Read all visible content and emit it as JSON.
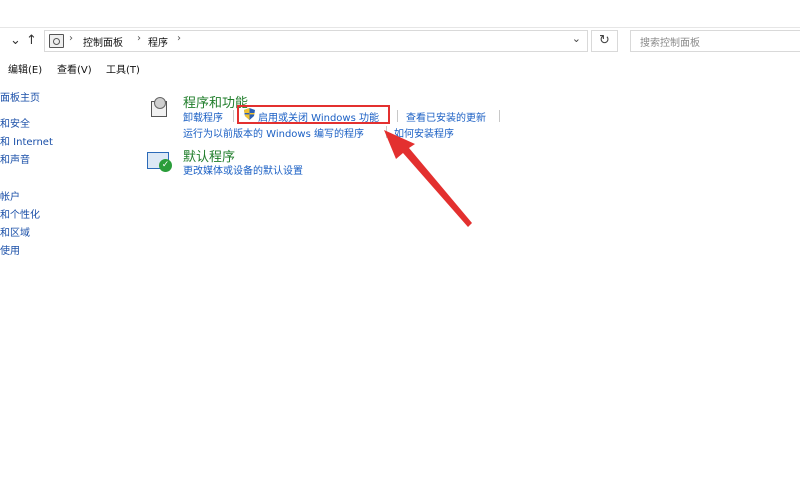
{
  "address": {
    "crumbs": [
      "控制面板",
      "程序"
    ],
    "search_placeholder": "搜索控制面板"
  },
  "menu": {
    "edit": "编辑(E)",
    "view": "查看(V)",
    "tools": "工具(T)"
  },
  "left_nav": {
    "items": [
      "面板主页",
      "和安全",
      "和 Internet",
      "和声音",
      "帐户",
      "和个性化",
      "和区域",
      "使用"
    ]
  },
  "programs_and_features": {
    "title": "程序和功能",
    "links": {
      "uninstall": "卸载程序",
      "windows_features": "启用或关闭 Windows 功能",
      "view_updates": "查看已安装的更新",
      "compat": "运行为以前版本的 Windows 编写的程序",
      "how_install": "如何安装程序"
    }
  },
  "default_programs": {
    "title": "默认程序",
    "links": {
      "change_media": "更改媒体或设备的默认设置"
    }
  },
  "colors": {
    "link": "#1a5fc4",
    "section_title": "#1f7d2a",
    "highlight": "#e3302f"
  }
}
